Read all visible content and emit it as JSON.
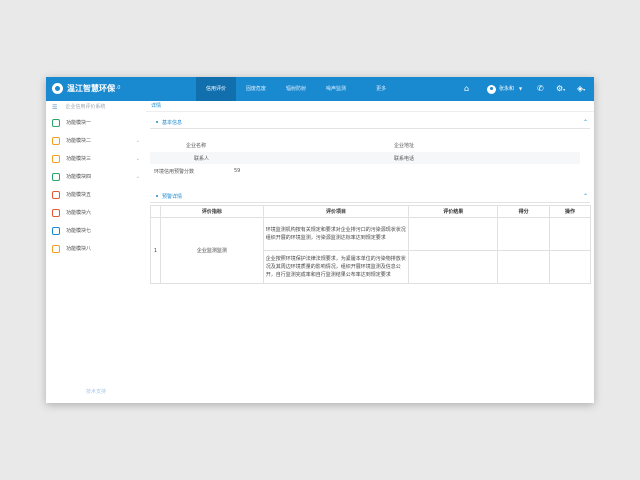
{
  "header": {
    "brand": "温江智慧环保",
    "version": "V3.0",
    "nav": [
      "信用评价",
      "固废危废",
      "辐射防射",
      "噪声监测",
      "更多"
    ],
    "user_name": "张永和",
    "icons": [
      "home-icon",
      "user-icon",
      "phone-icon",
      "settings-icon",
      "layers-icon"
    ]
  },
  "sidebar": {
    "header": "企业信用评价系统",
    "items": [
      {
        "label": "功能模块一",
        "color": "#2aa36b",
        "chevron": false
      },
      {
        "label": "功能模块二",
        "color": "#f0a020",
        "chevron": true
      },
      {
        "label": "功能模块三",
        "color": "#f0a020",
        "chevron": true
      },
      {
        "label": "功能模块四",
        "color": "#2aa36b",
        "chevron": true
      },
      {
        "label": "功能模块五",
        "color": "#e05a3a",
        "chevron": false
      },
      {
        "label": "功能模块六",
        "color": "#e05a3a",
        "chevron": false
      },
      {
        "label": "功能模块七",
        "color": "#1a8ad0",
        "chevron": false
      },
      {
        "label": "功能模块八",
        "color": "#f0a020",
        "chevron": false
      }
    ],
    "footer": "技术支持"
  },
  "content": {
    "breadcrumb": "详情",
    "basic_title": "基本信息",
    "fields": {
      "company_name_label": "企业名称",
      "company_addr_label": "企业地址",
      "contact_label": "联系人",
      "phone_label": "联系电话",
      "score_label": "环境信用预警分数",
      "score_value": "59"
    },
    "detail_title": "预警详情",
    "table": {
      "headers": [
        "",
        "评价指标",
        "评价项目",
        "评价结果",
        "得分",
        "操作"
      ],
      "row_index": "1",
      "indicator": "企业监测监测",
      "items": [
        "环境监测机构按有关规定和要求对企业排污口的污染源现状状况组织开展的环境监测，污染源监测达标率达到规定要求",
        "企业按照环境保护法律法规要求，为紧履本单位的污染物排放状况及其周边环境质量的影响情况，组织开展环境监测及信息公开，自行监测完成率和自行监测结果公布率达到规定要求"
      ]
    }
  }
}
